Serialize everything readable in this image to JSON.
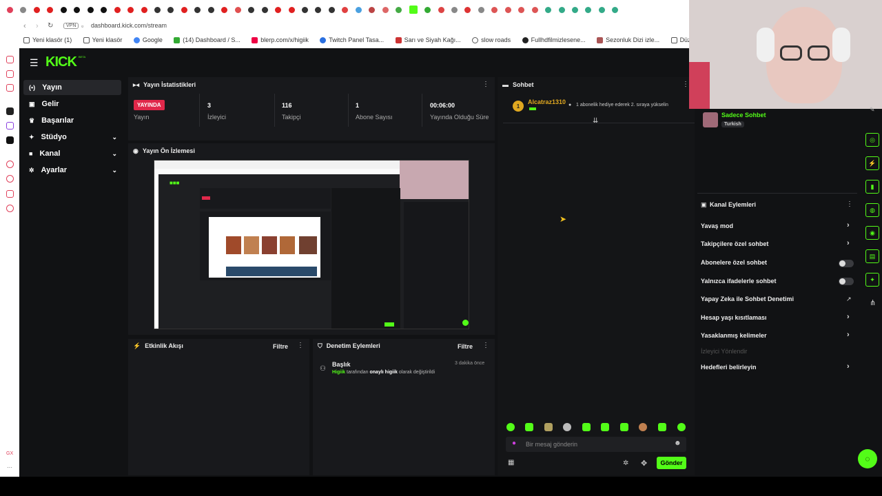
{
  "browser": {
    "url": "dashboard.kick.com/stream",
    "vpn_label": "VPN",
    "bookmarks": [
      "Yeni klasör (1)",
      "Yeni klasör",
      "Google",
      "(14) Dashboard / S...",
      "blerp.com/x/higiik",
      "Twitch Panel Tasa...",
      "Sarı ve Siyah Kağı...",
      "slow roads",
      "Fullhdfilmizlesene...",
      "Sezonluk Dizi izle...",
      "Düzlçi Namaz Vak"
    ]
  },
  "app": {
    "logo": "KICK",
    "logo_badge": "BETA",
    "accent": "#53fc18"
  },
  "sidebar": {
    "items": [
      {
        "label": "Yayın",
        "icon": "broadcast-icon"
      },
      {
        "label": "Gelir",
        "icon": "money-icon"
      },
      {
        "label": "Başarılar",
        "icon": "trophy-icon"
      },
      {
        "label": "Stüdyo",
        "icon": "studio-icon"
      },
      {
        "label": "Kanal",
        "icon": "channel-icon"
      },
      {
        "label": "Ayarlar",
        "icon": "gear-icon"
      }
    ]
  },
  "stats": {
    "title": "Yayın İstatistikleri",
    "live_badge": "YAYINDA",
    "live_label": "Yayın",
    "viewers_value": "3",
    "viewers_label": "İzleyici",
    "followers_value": "116",
    "followers_label": "Takipçi",
    "subs_value": "1",
    "subs_label": "Abone Sayısı",
    "uptime_value": "00:06:00",
    "uptime_label": "Yayında Olduğu Süre"
  },
  "preview": {
    "title": "Yayın Ön İzlemesi"
  },
  "activity": {
    "title": "Etkinlik Akışı",
    "filter": "Filtre"
  },
  "moderation": {
    "title": "Denetim Eylemleri",
    "filter": "Filtre",
    "entry_title": "Başlık",
    "entry_time": "3 dakika önce",
    "entry_user": "Higiik",
    "entry_mid": "tarafından",
    "entry_value": "onaylı higiik",
    "entry_tail": "olarak değiştirildi"
  },
  "chat": {
    "title": "Sohbet",
    "pinned_user": "Alcatraz1310",
    "pinned_msg": "1 abonelik hediye ederek 2. sıraya yükselin",
    "input_placeholder": "Bir mesaj gönderin",
    "send_label": "Gönder"
  },
  "right_panel": {
    "mode_title": "Sadece Sohbet",
    "mode_lang": "Turkish",
    "actions_title": "Kanal Eylemleri",
    "slow_mode": "Yavaş mod",
    "followers_only": "Takipçilere özel sohbet",
    "subs_only": "Abonelere özel sohbet",
    "emotes_only": "Yalnızca ifadelerle sohbet",
    "ai_moderation": "Yapay Zeka ile Sohbet Denetimi",
    "account_age": "Hesap yaşı kısıtlaması",
    "banned_words": "Yasaklanmış kelimeler",
    "viewer_redirect": "İzleyici Yönlendir",
    "goals": "Hedefleri belirleyin"
  }
}
